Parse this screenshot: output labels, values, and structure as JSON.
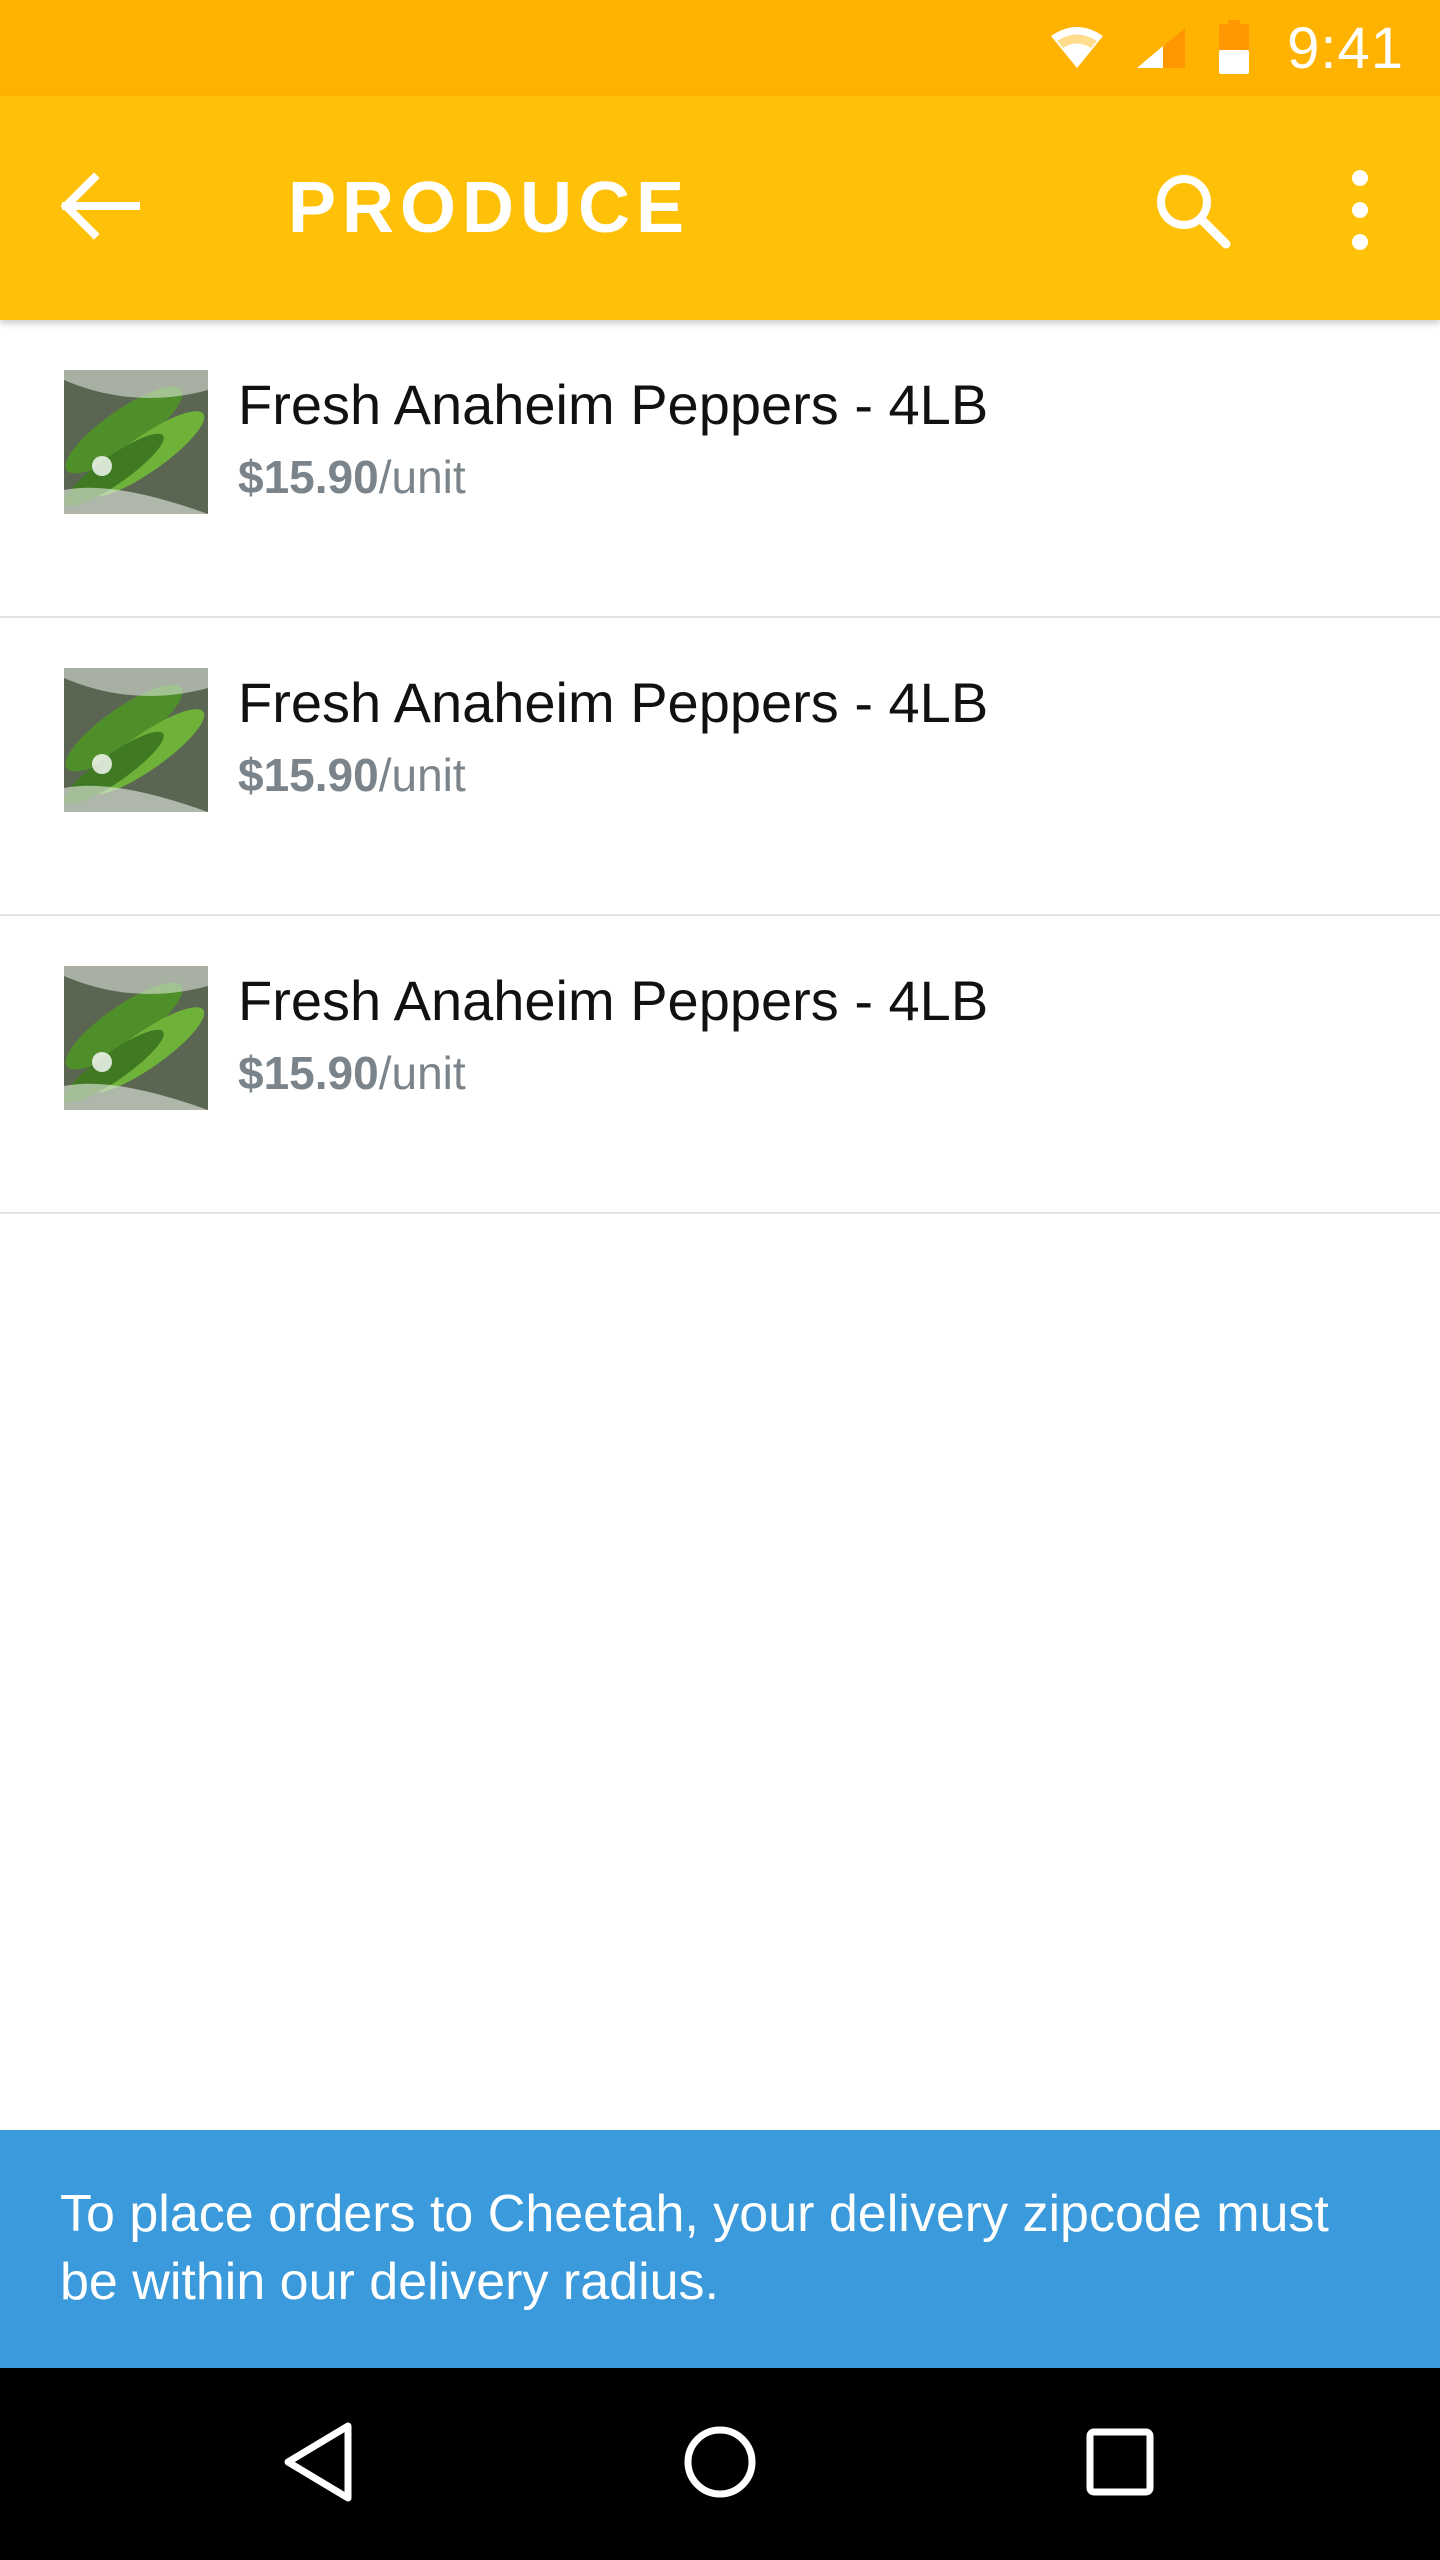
{
  "status_bar": {
    "time": "9:41",
    "icons": [
      "wifi-icon",
      "cell-signal-icon",
      "battery-icon"
    ]
  },
  "app_bar": {
    "title": "PRODUCE",
    "icons": [
      "back-arrow-icon",
      "search-icon",
      "more-vert-icon"
    ]
  },
  "products": [
    {
      "name": "Fresh Anaheim Peppers - 4LB",
      "price": "$15.90",
      "unit": "/unit"
    },
    {
      "name": "Fresh Anaheim Peppers - 4LB",
      "price": "$15.90",
      "unit": "/unit"
    },
    {
      "name": "Fresh Anaheim Peppers - 4LB",
      "price": "$15.90",
      "unit": "/unit"
    }
  ],
  "banner": {
    "message": "To place orders to Cheetah, your delivery zipcode must be within our delivery radius."
  },
  "nav_bar": {
    "icons": [
      "back-triangle-icon",
      "home-circle-icon",
      "recents-square-icon"
    ]
  },
  "colors": {
    "status_bar": "#FFB300",
    "app_bar": "#FFC107",
    "banner": "#3A9ADB",
    "price_text": "#7B848A"
  }
}
